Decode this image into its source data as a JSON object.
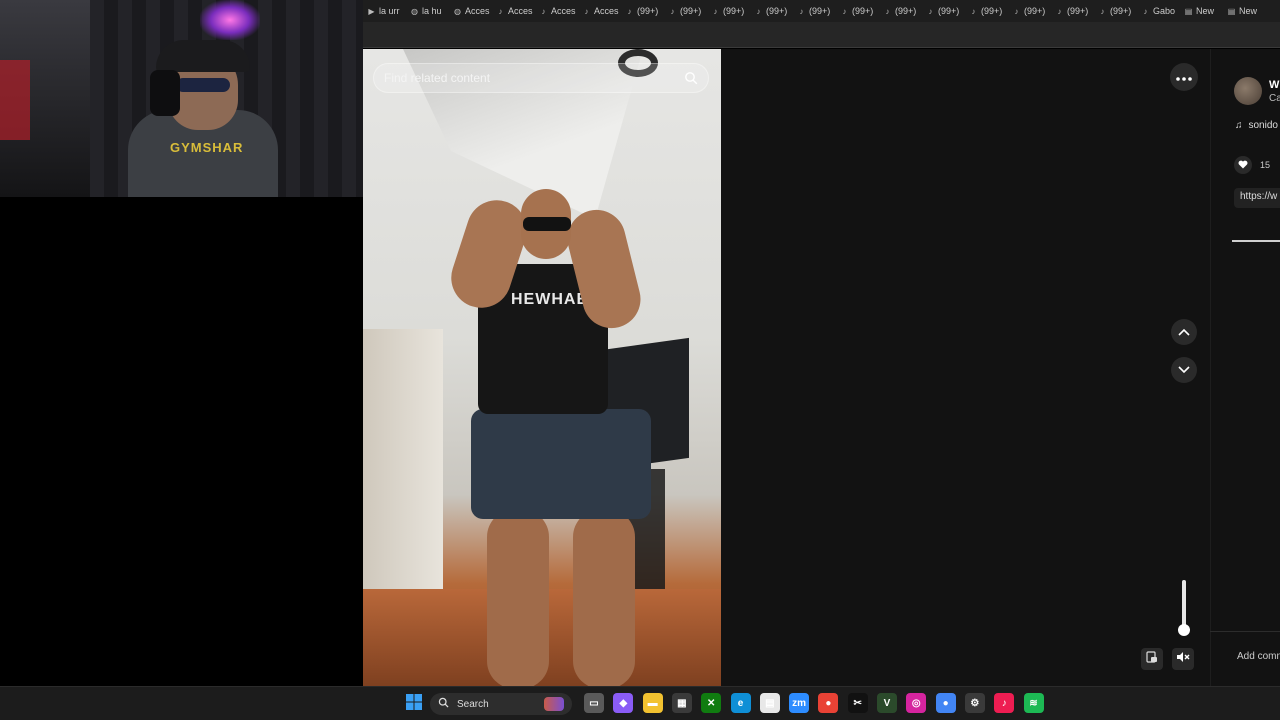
{
  "browser": {
    "tabs": [
      {
        "icon": "video-icon",
        "label": "la urr"
      },
      {
        "icon": "globe-icon",
        "label": "la hu"
      },
      {
        "icon": "globe-icon",
        "label": "Acces"
      },
      {
        "icon": "tiktok-icon",
        "label": "Acces"
      },
      {
        "icon": "tiktok-icon",
        "label": "Acces"
      },
      {
        "icon": "tiktok-icon",
        "label": "Acces"
      },
      {
        "icon": "tiktok-icon",
        "label": "(99+)"
      },
      {
        "icon": "tiktok-icon",
        "label": "(99+)"
      },
      {
        "icon": "tiktok-icon",
        "label": "(99+)"
      },
      {
        "icon": "tiktok-icon",
        "label": "(99+)"
      },
      {
        "icon": "tiktok-icon",
        "label": "(99+)"
      },
      {
        "icon": "tiktok-icon",
        "label": "(99+)"
      },
      {
        "icon": "tiktok-icon",
        "label": "(99+)"
      },
      {
        "icon": "tiktok-icon",
        "label": "(99+)"
      },
      {
        "icon": "tiktok-icon",
        "label": "(99+)"
      },
      {
        "icon": "tiktok-icon",
        "label": "(99+)"
      },
      {
        "icon": "tiktok-icon",
        "label": "(99+)"
      },
      {
        "icon": "tiktok-icon",
        "label": "(99+)"
      },
      {
        "icon": "tiktok-icon",
        "label": "Gabo"
      },
      {
        "icon": "page-icon",
        "label": "New"
      },
      {
        "icon": "page-icon",
        "label": "New"
      }
    ]
  },
  "webcam": {
    "shirt_text": "GYMSHAR"
  },
  "video": {
    "shirt_word": "HEWHAE",
    "search_placeholder": "Find related content"
  },
  "side_panel": {
    "username": "W",
    "subtitle": "Ca",
    "music": "sonido",
    "like_count": "15",
    "link": "https://w",
    "add_comment": "Add comm"
  },
  "volume": {
    "level": 1.0
  },
  "taskbar": {
    "search_label": "Search",
    "apps": [
      {
        "name": "task-view-icon",
        "color": "#5a5a5a",
        "glyph": "▭"
      },
      {
        "name": "copilot-icon",
        "color": "#8a5cf6",
        "glyph": "◆"
      },
      {
        "name": "file-explorer-icon",
        "color": "#f2c230",
        "glyph": "▬"
      },
      {
        "name": "store-icon",
        "color": "#3a3a3a",
        "glyph": "▦"
      },
      {
        "name": "xbox-icon",
        "color": "#107c10",
        "glyph": "✕"
      },
      {
        "name": "edge-icon",
        "color": "#0f8fd6",
        "glyph": "e"
      },
      {
        "name": "notepad-icon",
        "color": "#e8e8e8",
        "glyph": "▤"
      },
      {
        "name": "zoom-icon",
        "color": "#2d8cff",
        "glyph": "zm"
      },
      {
        "name": "chrome-icon",
        "color": "#e94235",
        "glyph": "●"
      },
      {
        "name": "capcut-icon",
        "color": "#111111",
        "glyph": "✂"
      },
      {
        "name": "vegas-icon",
        "color": "#2b4a2b",
        "glyph": "V"
      },
      {
        "name": "instagram-icon",
        "color": "#d6249f",
        "glyph": "◎"
      },
      {
        "name": "chrome-alt-icon",
        "color": "#4285f4",
        "glyph": "●"
      },
      {
        "name": "settings-icon",
        "color": "#3a3a3a",
        "glyph": "⚙"
      },
      {
        "name": "tiktok-icon",
        "color": "#ee1d52",
        "glyph": "♪"
      },
      {
        "name": "spotify-icon",
        "color": "#1db954",
        "glyph": "≋"
      }
    ]
  },
  "colors": {
    "panel_bg": "#121212",
    "button_bg": "#2a2a2a",
    "taskbar_bg": "#1c1c1c"
  }
}
